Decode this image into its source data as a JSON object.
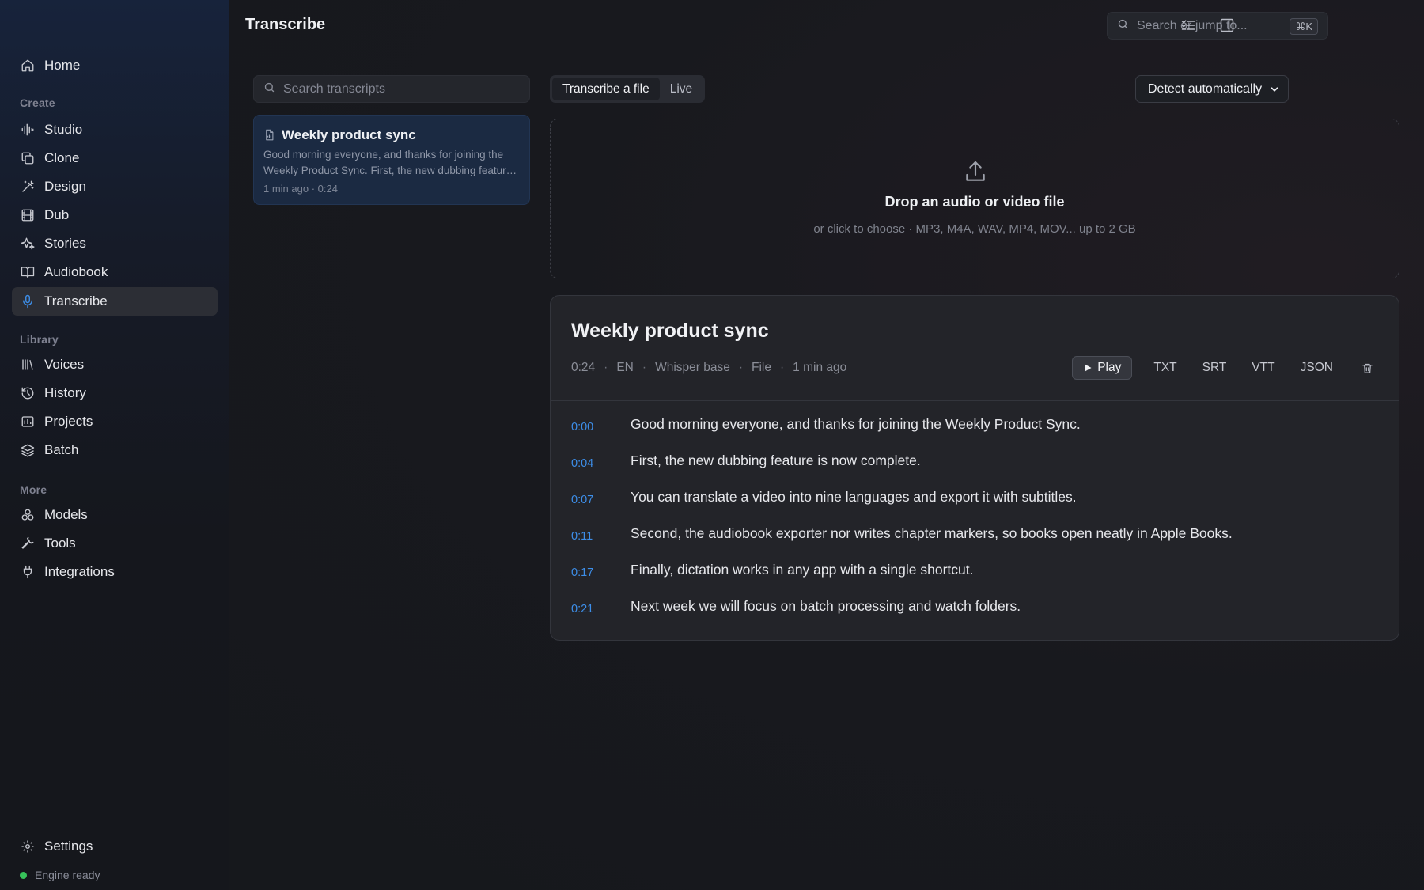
{
  "sidebar": {
    "nav_home": "Home",
    "section_create": "Create",
    "create_items": [
      "Studio",
      "Clone",
      "Design",
      "Dub",
      "Stories",
      "Audiobook",
      "Transcribe"
    ],
    "section_library": "Library",
    "library_items": [
      "Voices",
      "History",
      "Projects",
      "Batch"
    ],
    "section_more": "More",
    "more_items": [
      "Models",
      "Tools",
      "Integrations"
    ],
    "settings": "Settings",
    "engine_status": "Engine ready",
    "active_item": "Transcribe"
  },
  "header": {
    "title": "Transcribe",
    "search_placeholder": "Search or jump to...",
    "shortcut": "⌘K"
  },
  "transcripts": {
    "search_placeholder": "Search transcripts",
    "items": [
      {
        "title": "Weekly product sync",
        "snippet": "Good morning everyone, and thanks for joining the Weekly Product Sync. First, the new dubbing feature is now complete.",
        "meta": "1 min ago · 0:24"
      }
    ]
  },
  "tabs": {
    "file": "Transcribe a file",
    "live": "Live",
    "active": "file"
  },
  "language_select": {
    "value": "Detect automatically"
  },
  "dropzone": {
    "title": "Drop an audio or video file",
    "subtitle": "or click to choose · MP3, M4A, WAV, MP4, MOV... up to 2 GB"
  },
  "detail": {
    "title": "Weekly product sync",
    "duration": "0:24",
    "language": "EN",
    "model": "Whisper base",
    "source": "File",
    "time_ago": "1 min ago",
    "play_label": "Play",
    "formats": [
      "TXT",
      "SRT",
      "VTT",
      "JSON"
    ],
    "segments": [
      {
        "time": "0:00",
        "text": "Good morning everyone, and thanks for joining the Weekly Product Sync."
      },
      {
        "time": "0:04",
        "text": "First, the new dubbing feature is now complete."
      },
      {
        "time": "0:07",
        "text": "You can translate a video into nine languages and export it with subtitles."
      },
      {
        "time": "0:11",
        "text": "Second, the audiobook exporter nor writes chapter markers, so books open neatly in Apple Books."
      },
      {
        "time": "0:17",
        "text": "Finally, dictation works in any app with a single shortcut."
      },
      {
        "time": "0:21",
        "text": "Next week we will focus on batch processing and watch folders."
      }
    ]
  },
  "colors": {
    "accent": "#3d8ee8",
    "status_ready": "#37c25a",
    "card_selected": "#1b2a42"
  }
}
